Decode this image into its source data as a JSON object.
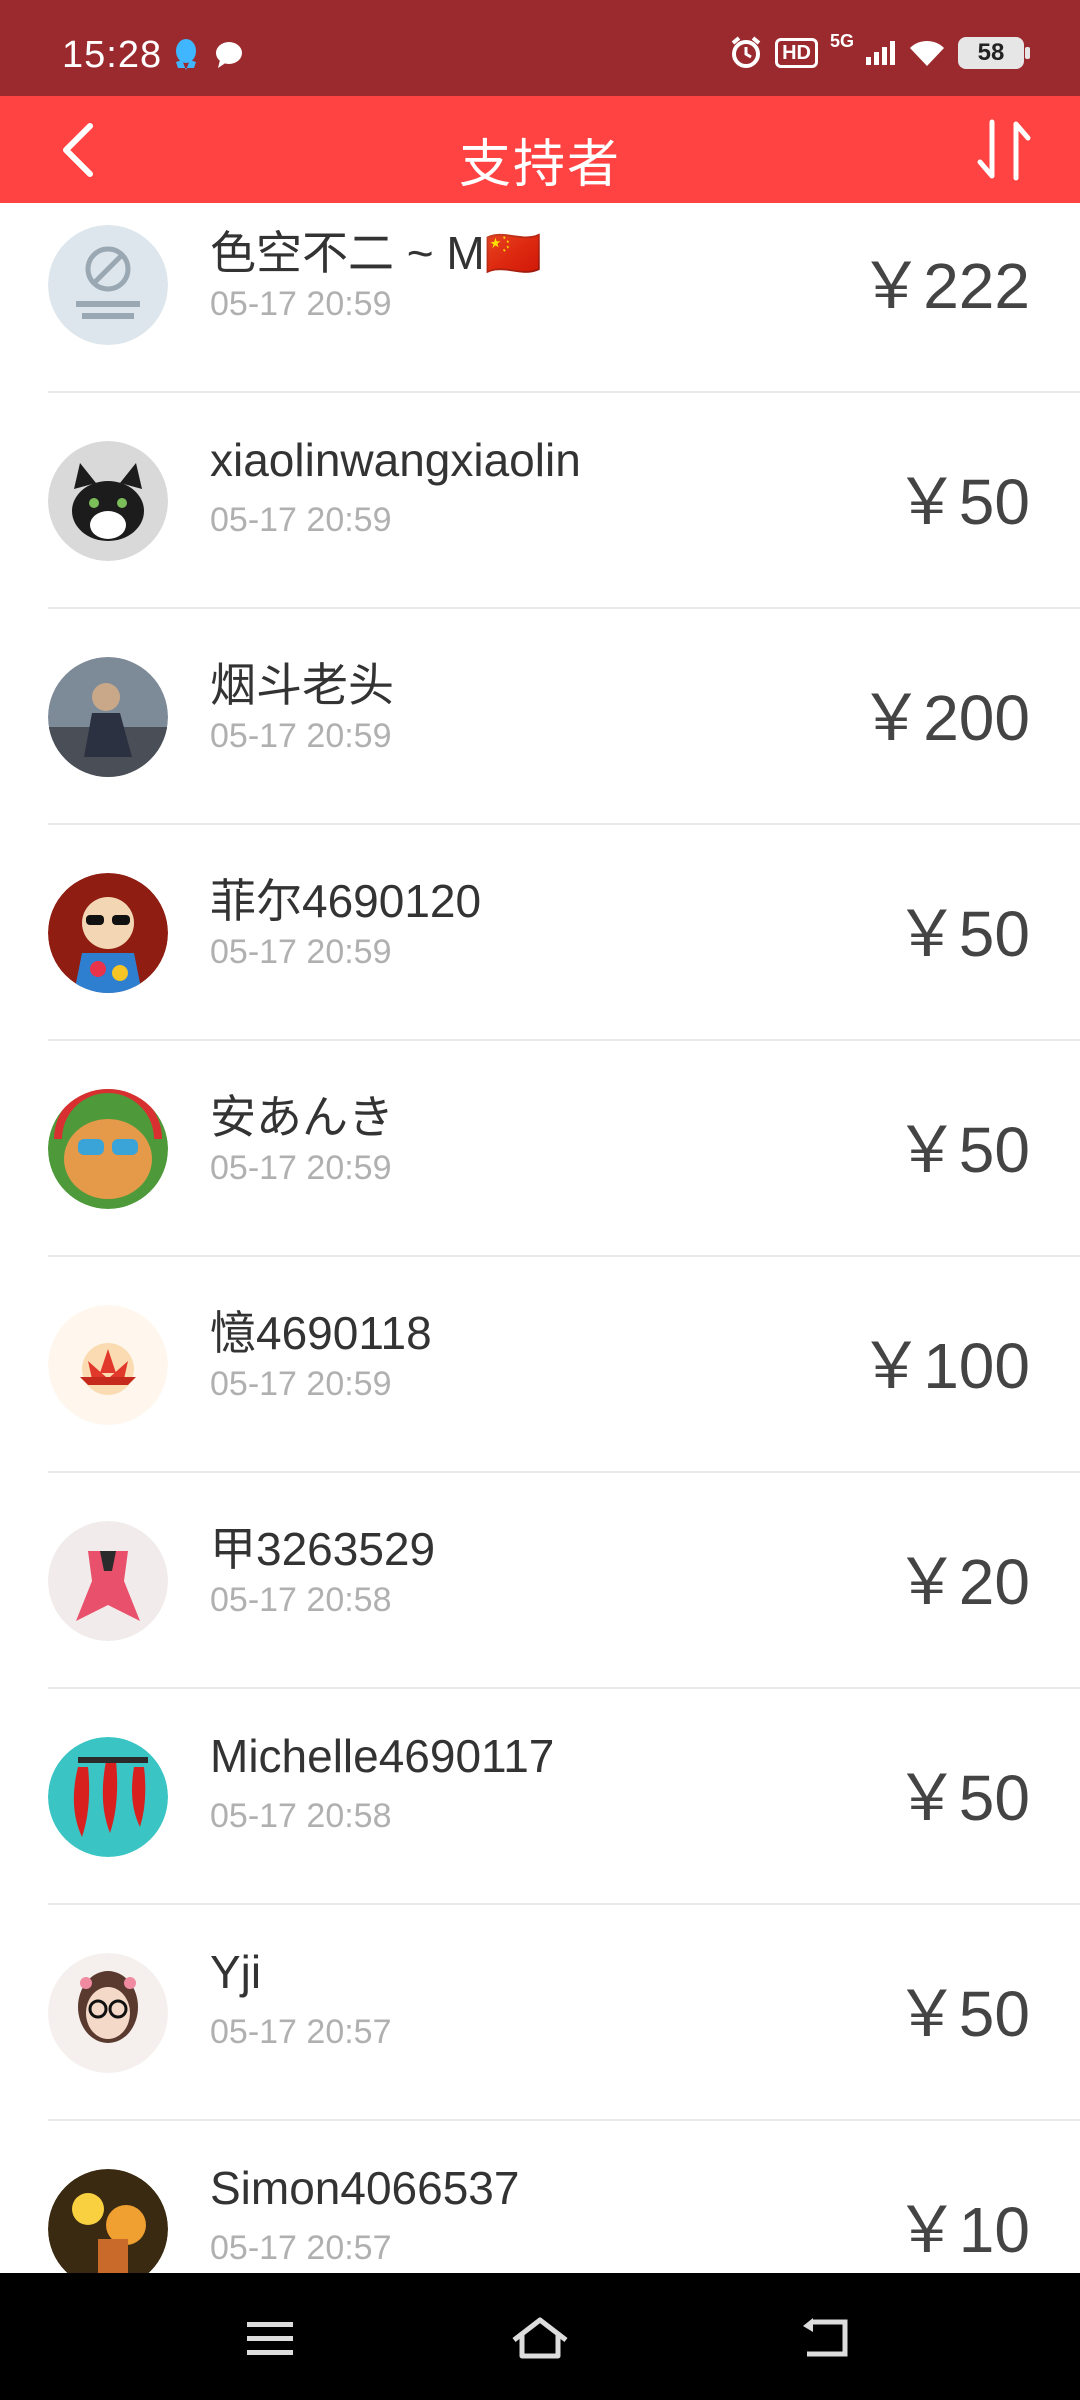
{
  "status_bar": {
    "time": "15:28",
    "battery": "58",
    "network": "5G",
    "hd": "HD"
  },
  "app_bar": {
    "title": "支持者"
  },
  "supporters": [
    {
      "name": "色空不二 ~ M🇨🇳",
      "time": "05-17 20:59",
      "amount": "￥222",
      "avatar_icon": "blocked-image-avatar"
    },
    {
      "name": "xiaolinwangxiaolin",
      "time": "05-17 20:59",
      "amount": "￥50",
      "avatar_icon": "cat-avatar"
    },
    {
      "name": "烟斗老头",
      "time": "05-17 20:59",
      "amount": "￥200",
      "avatar_icon": "man-photo-avatar"
    },
    {
      "name": "菲尔4690120",
      "time": "05-17 20:59",
      "amount": "￥50",
      "avatar_icon": "cartoon-girl-avatar"
    },
    {
      "name": "安あんき",
      "time": "05-17 20:59",
      "amount": "￥50",
      "avatar_icon": "cat-sunglasses-avatar"
    },
    {
      "name": "憶4690118",
      "time": "05-17 20:59",
      "amount": "￥100",
      "avatar_icon": "lotus-avatar"
    },
    {
      "name": "甲3263529",
      "time": "05-17 20:58",
      "amount": "￥20",
      "avatar_icon": "pink-scarf-avatar"
    },
    {
      "name": "Michelle4690117",
      "time": "05-17 20:58",
      "amount": "￥50",
      "avatar_icon": "chili-avatar"
    },
    {
      "name": "Yji",
      "time": "05-17 20:57",
      "amount": "￥50",
      "avatar_icon": "girl-glasses-avatar"
    },
    {
      "name": "Simon4066537",
      "time": "05-17 20:57",
      "amount": "￥10",
      "avatar_icon": "lights-avatar"
    }
  ],
  "colors": {
    "status_bar": "#9b2a2e",
    "app_bar": "#ff4242",
    "nav_bar": "#000000"
  }
}
